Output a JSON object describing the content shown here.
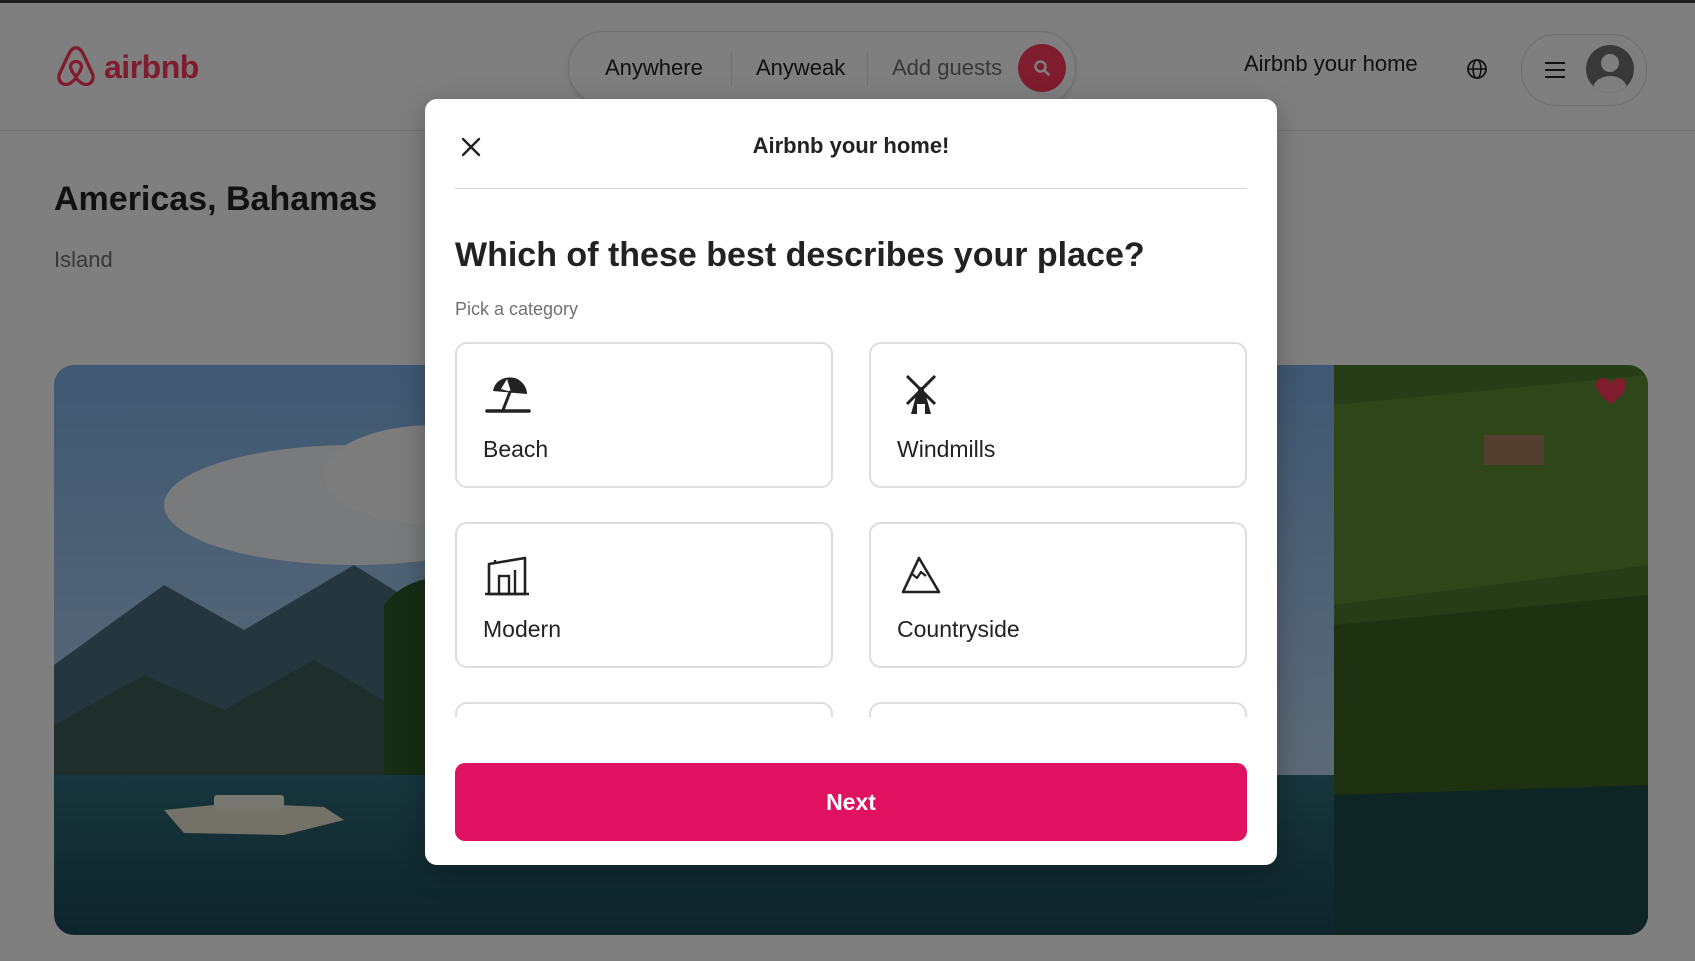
{
  "header": {
    "logo_text": "airbnb",
    "search": {
      "location": "Anywhere",
      "dates": "Anyweak",
      "guests_placeholder": "Add guests"
    },
    "host_link": "Airbnb your home"
  },
  "listing": {
    "title": "Americas, Bahamas",
    "subtitle": "Island"
  },
  "modal": {
    "title": "Airbnb your home!",
    "question": "Which of these best describes your place?",
    "hint": "Pick a category",
    "categories": [
      {
        "label": "Beach",
        "icon": "beach-umbrella-icon"
      },
      {
        "label": "Windmills",
        "icon": "windmill-icon"
      },
      {
        "label": "Modern",
        "icon": "modern-house-icon"
      },
      {
        "label": "Countryside",
        "icon": "mountain-icon"
      }
    ],
    "next_label": "Next"
  },
  "colors": {
    "brand": "#ff385c",
    "next_button": "#e01161",
    "overlay": "rgba(0,0,0,0.5)"
  }
}
